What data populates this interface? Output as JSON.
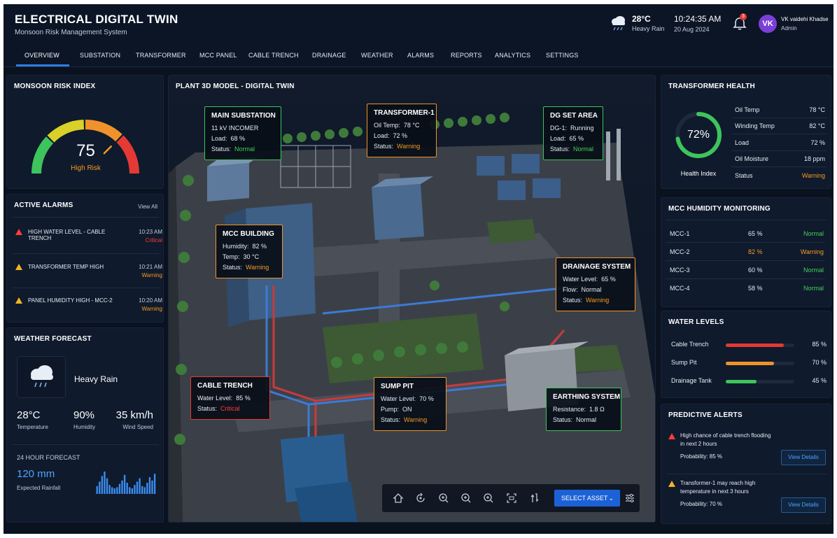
{
  "header": {
    "title": "ELECTRICAL DIGITAL TWIN",
    "subtitle": "Monsoon Risk Management System",
    "weather_temp": "28°C",
    "weather_condition": "Heavy Rain",
    "time": "10:24:35 AM",
    "date": "20 Aug 2024",
    "notification_count": "3",
    "user_initials": "VK",
    "user_name": "VK vaidehi Khadse",
    "user_role": "Admin"
  },
  "nav": {
    "tabs": [
      "OVERVIEW",
      "SUBSTATION",
      "TRANSFORMER",
      "MCC PANEL",
      "CABLE TRENCH",
      "DRAINAGE",
      "WEATHER",
      "ALARMS",
      "REPORTS",
      "ANALYTICS",
      "SETTINGS"
    ],
    "active": "OVERVIEW"
  },
  "risk": {
    "title": "MONSOON RISK INDEX",
    "value": "75",
    "value_fraction": 0.75,
    "label": "High Risk"
  },
  "alarms": {
    "title": "ACTIVE ALARMS",
    "view_all": "View All",
    "items": [
      {
        "text": "HIGH WATER LEVEL - CABLE TRENCH",
        "time": "10:23 AM",
        "severity": "Critical"
      },
      {
        "text": "TRANSFORMER TEMP HIGH",
        "time": "10:21 AM",
        "severity": "Warning"
      },
      {
        "text": "PANEL HUMIDITY HIGH - MCC-2",
        "time": "10:20 AM",
        "severity": "Warning"
      }
    ]
  },
  "forecast": {
    "title": "WEATHER FORECAST",
    "condition": "Heavy Rain",
    "temperature": "28°C",
    "temperature_label": "Temperature",
    "humidity": "90%",
    "humidity_label": "Humidity",
    "wind": "35 km/h",
    "wind_label": "Wind Speed",
    "hourly_title": "24 HOUR FORECAST",
    "rainfall": "120 mm",
    "rainfall_label": "Expected Rainfall",
    "hourly_bars": [
      0.35,
      0.55,
      0.8,
      1.0,
      0.7,
      0.4,
      0.3,
      0.25,
      0.3,
      0.45,
      0.6,
      0.85,
      0.5,
      0.3,
      0.25,
      0.4,
      0.55,
      0.7,
      0.35,
      0.3,
      0.5,
      0.75,
      0.6,
      0.9
    ]
  },
  "model": {
    "title": "PLANT 3D MODEL - DIGITAL TWIN",
    "select_asset": "SELECT ASSET",
    "tags": {
      "substation": {
        "title": "MAIN SUBSTATION",
        "line1": "11 kV INCOMER",
        "line2_label": "Load:",
        "line2_value": "68 %",
        "status_label": "Status:",
        "status": "Normal"
      },
      "transformer": {
        "title": "TRANSFORMER-1",
        "line1_label": "Oil Temp:",
        "line1_value": "78 °C",
        "line2_label": "Load:",
        "line2_value": "72 %",
        "status_label": "Status:",
        "status": "Warning"
      },
      "dg": {
        "title": "DG SET AREA",
        "line1_label": "DG-1:",
        "line1_value": "Running",
        "line2_label": "Load:",
        "line2_value": "65 %",
        "status_label": "Status:",
        "status": "Normal"
      },
      "mcc": {
        "title": "MCC BUILDING",
        "line1_label": "Humidity:",
        "line1_value": "82 %",
        "line2_label": "Temp:",
        "line2_value": "30 °C",
        "status_label": "Status:",
        "status": "Warning"
      },
      "drainage": {
        "title": "DRAINAGE SYSTEM",
        "line1_label": "Water Level:",
        "line1_value": "65 %",
        "line2_label": "Flow:",
        "line2_value": "Normal",
        "status_label": "Status:",
        "status": "Warning"
      },
      "cable": {
        "title": "CABLE TRENCH",
        "line1_label": "Water Level:",
        "line1_value": "85 %",
        "status_label": "Status:",
        "status": "Critical"
      },
      "sump": {
        "title": "SUMP PIT",
        "line1_label": "Water Level:",
        "line1_value": "70 %",
        "line2_label": "Pump:",
        "line2_value": "ON",
        "status_label": "Status:",
        "status": "Warning"
      },
      "earthing": {
        "title": "EARTHING SYSTEM",
        "line1_label": "Resistance:",
        "line1_value": "1.8 Ω",
        "status_label": "Status:",
        "status": "Normal"
      }
    }
  },
  "transformer_health": {
    "title": "TRANSFORMER HEALTH",
    "value": "72%",
    "value_fraction": 0.72,
    "label": "Health Index",
    "rows": [
      {
        "label": "Oil Temp",
        "value": "78 °C"
      },
      {
        "label": "Winding Temp",
        "value": "82 °C"
      },
      {
        "label": "Load",
        "value": "72 %"
      },
      {
        "label": "Oil Moisture",
        "value": "18 ppm"
      },
      {
        "label": "Status",
        "value": "Warning"
      }
    ]
  },
  "mcc_humidity": {
    "title": "MCC HUMIDITY MONITORING",
    "rows": [
      {
        "name": "MCC-1",
        "value": "65 %",
        "status": "Normal"
      },
      {
        "name": "MCC-2",
        "value": "82 %",
        "status": "Warning"
      },
      {
        "name": "MCC-3",
        "value": "60 %",
        "status": "Normal"
      },
      {
        "name": "MCC-4",
        "value": "58 %",
        "status": "Normal"
      }
    ]
  },
  "water_levels": {
    "title": "WATER LEVELS",
    "rows": [
      {
        "label": "Cable Trench",
        "value": "85 %",
        "fraction": 0.85,
        "color": "#e53935"
      },
      {
        "label": "Sump Pit",
        "value": "70 %",
        "fraction": 0.7,
        "color": "#f0922b"
      },
      {
        "label": "Drainage Tank",
        "value": "45 %",
        "fraction": 0.45,
        "color": "#3ec45c"
      }
    ]
  },
  "predictive": {
    "title": "PREDICTIVE ALERTS",
    "items": [
      {
        "line1": "High chance of cable trench flooding",
        "line2": "in next 2 hours",
        "probability": "Probability: 85 %",
        "button": "View Details"
      },
      {
        "line1": "Transformer-1 may reach high",
        "line2": "temperature in next 3 hours",
        "probability": "Probability: 70 %",
        "button": "View Details"
      }
    ]
  },
  "colors": {
    "accent": "#2f7de1",
    "normal": "#43d15b",
    "warning": "#f59a23",
    "critical": "#ff3b3b"
  },
  "icons": {
    "header_weather": "cloud-rain-icon",
    "notifications": "bell-icon",
    "controls": [
      "home-icon",
      "rotate-icon",
      "zoom-in-icon",
      "zoom-in-icon",
      "zoom-in-icon",
      "fit-screen-icon",
      "reset-view-icon",
      "sliders-icon"
    ]
  }
}
